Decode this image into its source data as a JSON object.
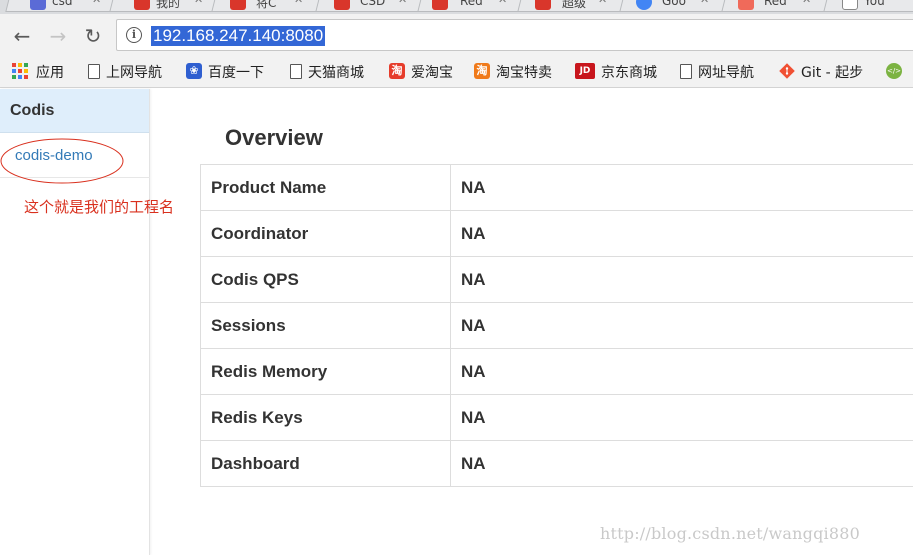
{
  "browser": {
    "tabs": [
      {
        "title": "csd",
        "favicon_color": "#5b6bd6"
      },
      {
        "title": "我的",
        "favicon_color": "#d9362b"
      },
      {
        "title": "将C",
        "favicon_color": "#d9362b"
      },
      {
        "title": "CSD",
        "favicon_color": "#d9362b"
      },
      {
        "title": "Red",
        "favicon_color": "#d9362b"
      },
      {
        "title": "超级",
        "favicon_color": "#d9362b"
      },
      {
        "title": "Goo",
        "favicon_color": "#4285f4"
      },
      {
        "title": "Red",
        "favicon_color": "#f06a5a"
      },
      {
        "title": "You",
        "favicon_color": "#ffffff"
      }
    ],
    "url": "192.168.247.140:8080",
    "icons": {
      "back": "back-arrow-icon",
      "forward": "forward-arrow-icon",
      "reload": "reload-icon",
      "info": "info-icon"
    }
  },
  "bookmarks": [
    {
      "label": "应用",
      "icon": "apps-grid-icon"
    },
    {
      "label": "上网导航",
      "icon": "page-icon"
    },
    {
      "label": "百度一下",
      "icon": "baidu-paw-icon"
    },
    {
      "label": "天猫商城",
      "icon": "page-icon"
    },
    {
      "label": "爱淘宝",
      "icon": "taobao-icon",
      "icon_text": "淘"
    },
    {
      "label": "淘宝特卖",
      "icon": "taobao-sale-icon",
      "icon_text": "淘"
    },
    {
      "label": "京东商城",
      "icon": "jd-icon",
      "icon_text": "JD"
    },
    {
      "label": "网址导航",
      "icon": "page-icon"
    },
    {
      "label": "Git - 起步",
      "icon": "git-icon"
    }
  ],
  "sidebar": {
    "header": "Codis",
    "items": [
      {
        "label": "codis-demo"
      }
    ]
  },
  "annotation": {
    "text": "这个就是我们的工程名",
    "color": "#d9301e"
  },
  "overview": {
    "title": "Overview",
    "rows": [
      {
        "key": "Product Name",
        "value": "NA"
      },
      {
        "key": "Coordinator",
        "value": "NA"
      },
      {
        "key": "Codis QPS",
        "value": "NA"
      },
      {
        "key": "Sessions",
        "value": "NA"
      },
      {
        "key": "Redis Memory",
        "value": "NA"
      },
      {
        "key": "Redis Keys",
        "value": "NA"
      },
      {
        "key": "Dashboard",
        "value": "NA"
      }
    ]
  },
  "watermark": "http://blog.csdn.net/wangqi880",
  "colors": {
    "sidebar_header_bg": "#dfeefb",
    "link": "#337ab7",
    "url_highlight": "#3367d6"
  }
}
